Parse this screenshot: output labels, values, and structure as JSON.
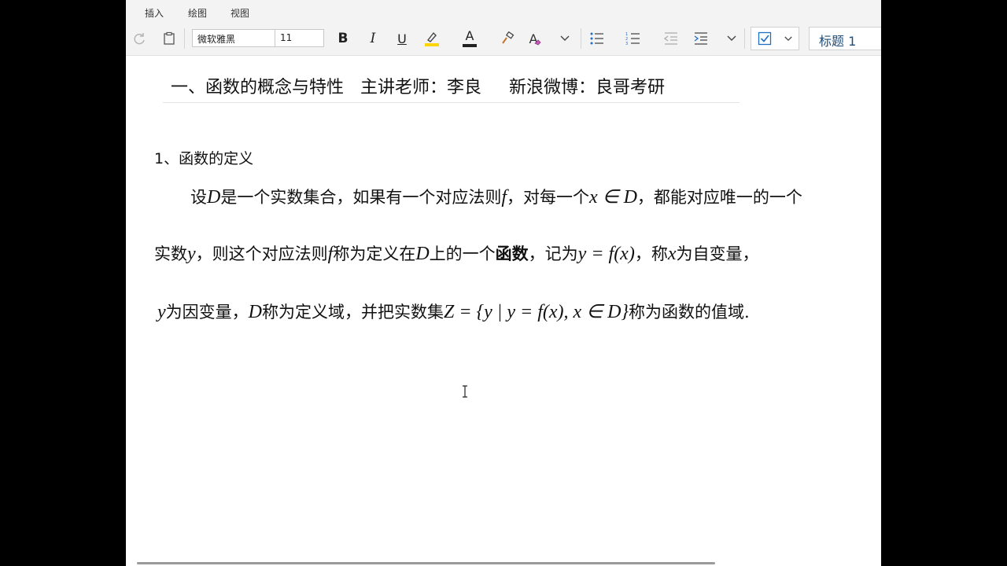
{
  "menu": {
    "tabs": [
      "插入",
      "绘图",
      "视图"
    ]
  },
  "toolbar": {
    "font_name": "微软雅黑",
    "font_size": "11",
    "bold_label": "B",
    "italic_label": "I",
    "underline_label": "U",
    "font_color_label": "A",
    "clear_format_label": "A",
    "style_name": "标题 1",
    "highlight_color": "#ffd400",
    "font_color": "#222222"
  },
  "document": {
    "title": "一、函数的概念与特性   主讲老师：李良     新浪微博：良哥考研",
    "section_heading": "1、函数的定义",
    "para": {
      "l1_a": "设",
      "l1_b": "D",
      "l1_c": "是一个实数集合，如果有一个对应法则",
      "l1_d": "f",
      "l1_e": "，对每一个",
      "l1_f": "x ∈ D",
      "l1_g": "，都能对应唯一的一个",
      "l2_a": "实数",
      "l2_b": "y",
      "l2_c": "，则这个对应法则",
      "l2_d": "f",
      "l2_e": "称为定义在",
      "l2_f": "D",
      "l2_g": "上的一个",
      "l2_h": "函数",
      "l2_i": "，记为",
      "l2_j": "y = f(x)",
      "l2_k": "，称",
      "l2_l": "x",
      "l2_m": "为自变量，",
      "l3_a": "y",
      "l3_b": "为因变量，",
      "l3_c": "D",
      "l3_d": "称为定义域，并把实数集",
      "l3_e": "Z = {y | y = f(x), x ∈ D}",
      "l3_f": "称为函数的值域."
    }
  }
}
